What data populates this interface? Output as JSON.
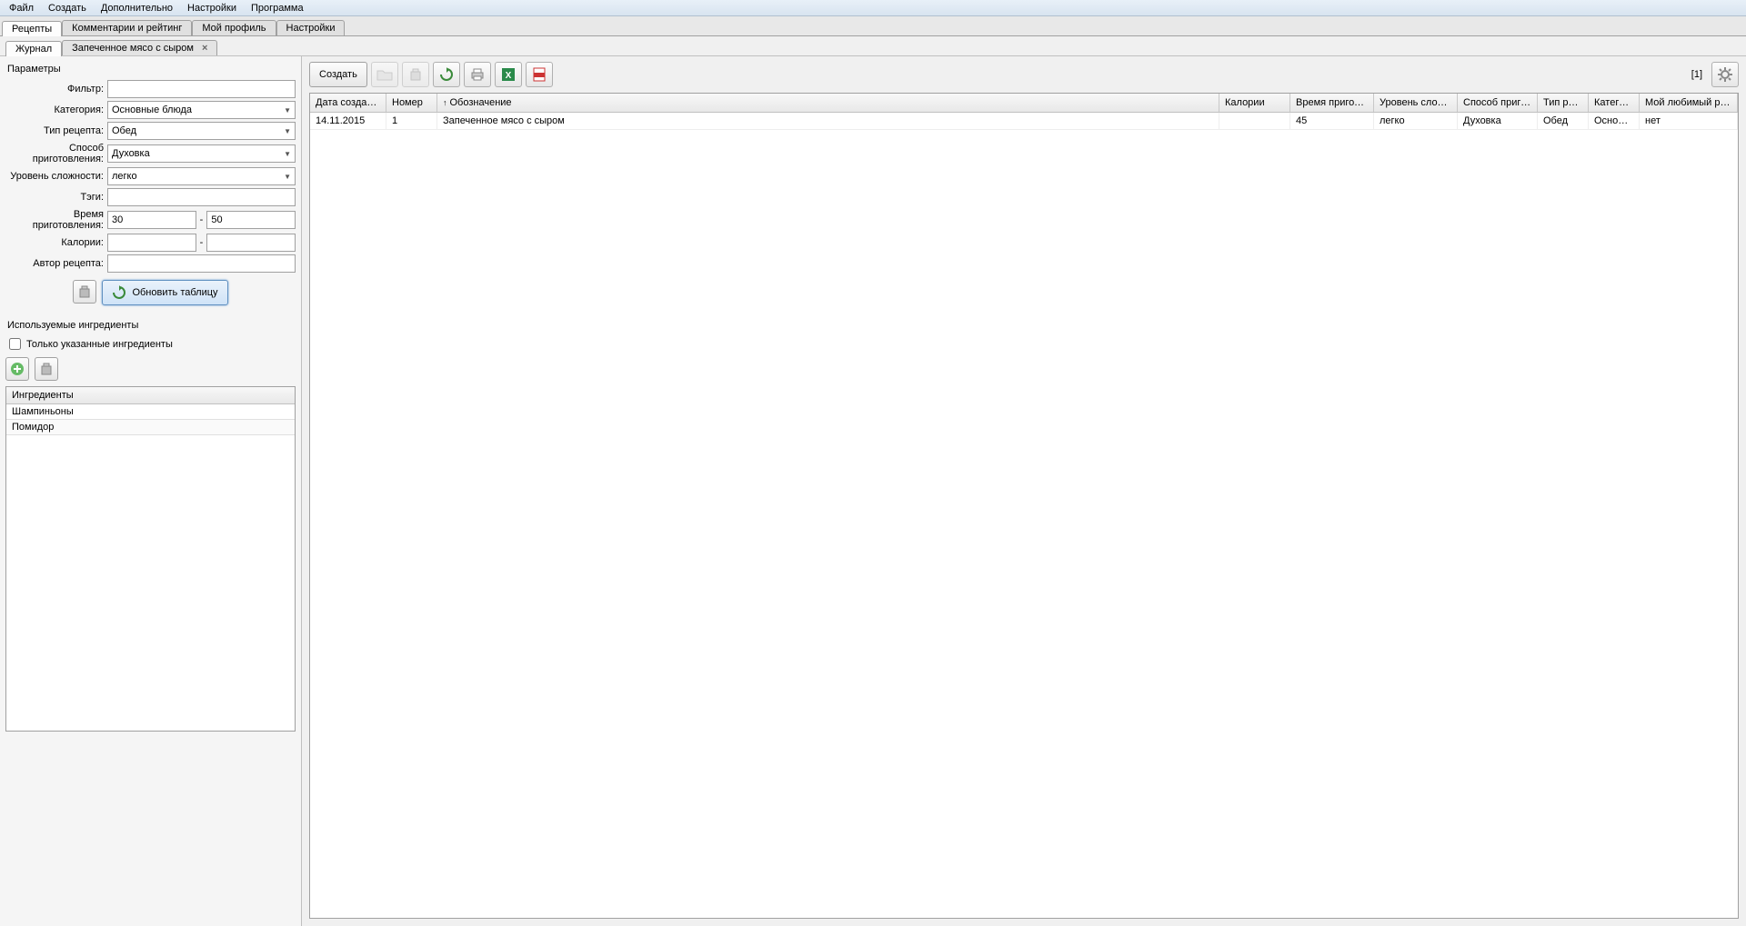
{
  "menu": {
    "file": "Файл",
    "create": "Создать",
    "extra": "Дополнительно",
    "settings": "Настройки",
    "program": "Программа"
  },
  "tabs": {
    "recipes": "Рецепты",
    "comments": "Комментарии и рейтинг",
    "profile": "Мой профиль",
    "settings": "Настройки"
  },
  "subtabs": {
    "journal": "Журнал",
    "item": "Запеченное мясо с сыром"
  },
  "params": {
    "title": "Параметры",
    "filter_label": "Фильтр:",
    "filter_value": "",
    "category_label": "Категория:",
    "category_value": "Основные блюда",
    "type_label": "Тип рецепта:",
    "type_value": "Обед",
    "method_label": "Способ приготовления:",
    "method_value": "Духовка",
    "difficulty_label": "Уровень сложности:",
    "difficulty_value": "легко",
    "tags_label": "Тэги:",
    "tags_value": "",
    "time_label": "Время приготовления:",
    "time_from": "30",
    "time_to": "50",
    "calories_label": "Калории:",
    "calories_from": "",
    "calories_to": "",
    "author_label": "Автор рецепта:",
    "author_value": "",
    "update_button": "Обновить таблицу"
  },
  "ingredients": {
    "title": "Используемые ингредиенты",
    "only_listed": "Только указанные ингредиенты",
    "header": "Ингредиенты",
    "rows": [
      "Шампиньоны",
      "Помидор"
    ]
  },
  "toolbar": {
    "create": "Создать",
    "counter": "[1]"
  },
  "grid": {
    "headers": {
      "date": "Дата создания",
      "num": "Номер",
      "name": "Обозначение",
      "cal": "Калории",
      "time": "Время приготовле…",
      "diff": "Уровень сложности",
      "method": "Способ приготовл…",
      "type": "Тип рецепта",
      "cat": "Категория",
      "fav": "Мой любимый рецепт"
    },
    "row": {
      "date": "14.11.2015",
      "num": "1",
      "name": "Запеченное мясо с сыром",
      "cal": "",
      "time": "45",
      "diff": "легко",
      "method": "Духовка",
      "type": "Обед",
      "cat": "Основны…",
      "fav": "нет"
    }
  }
}
